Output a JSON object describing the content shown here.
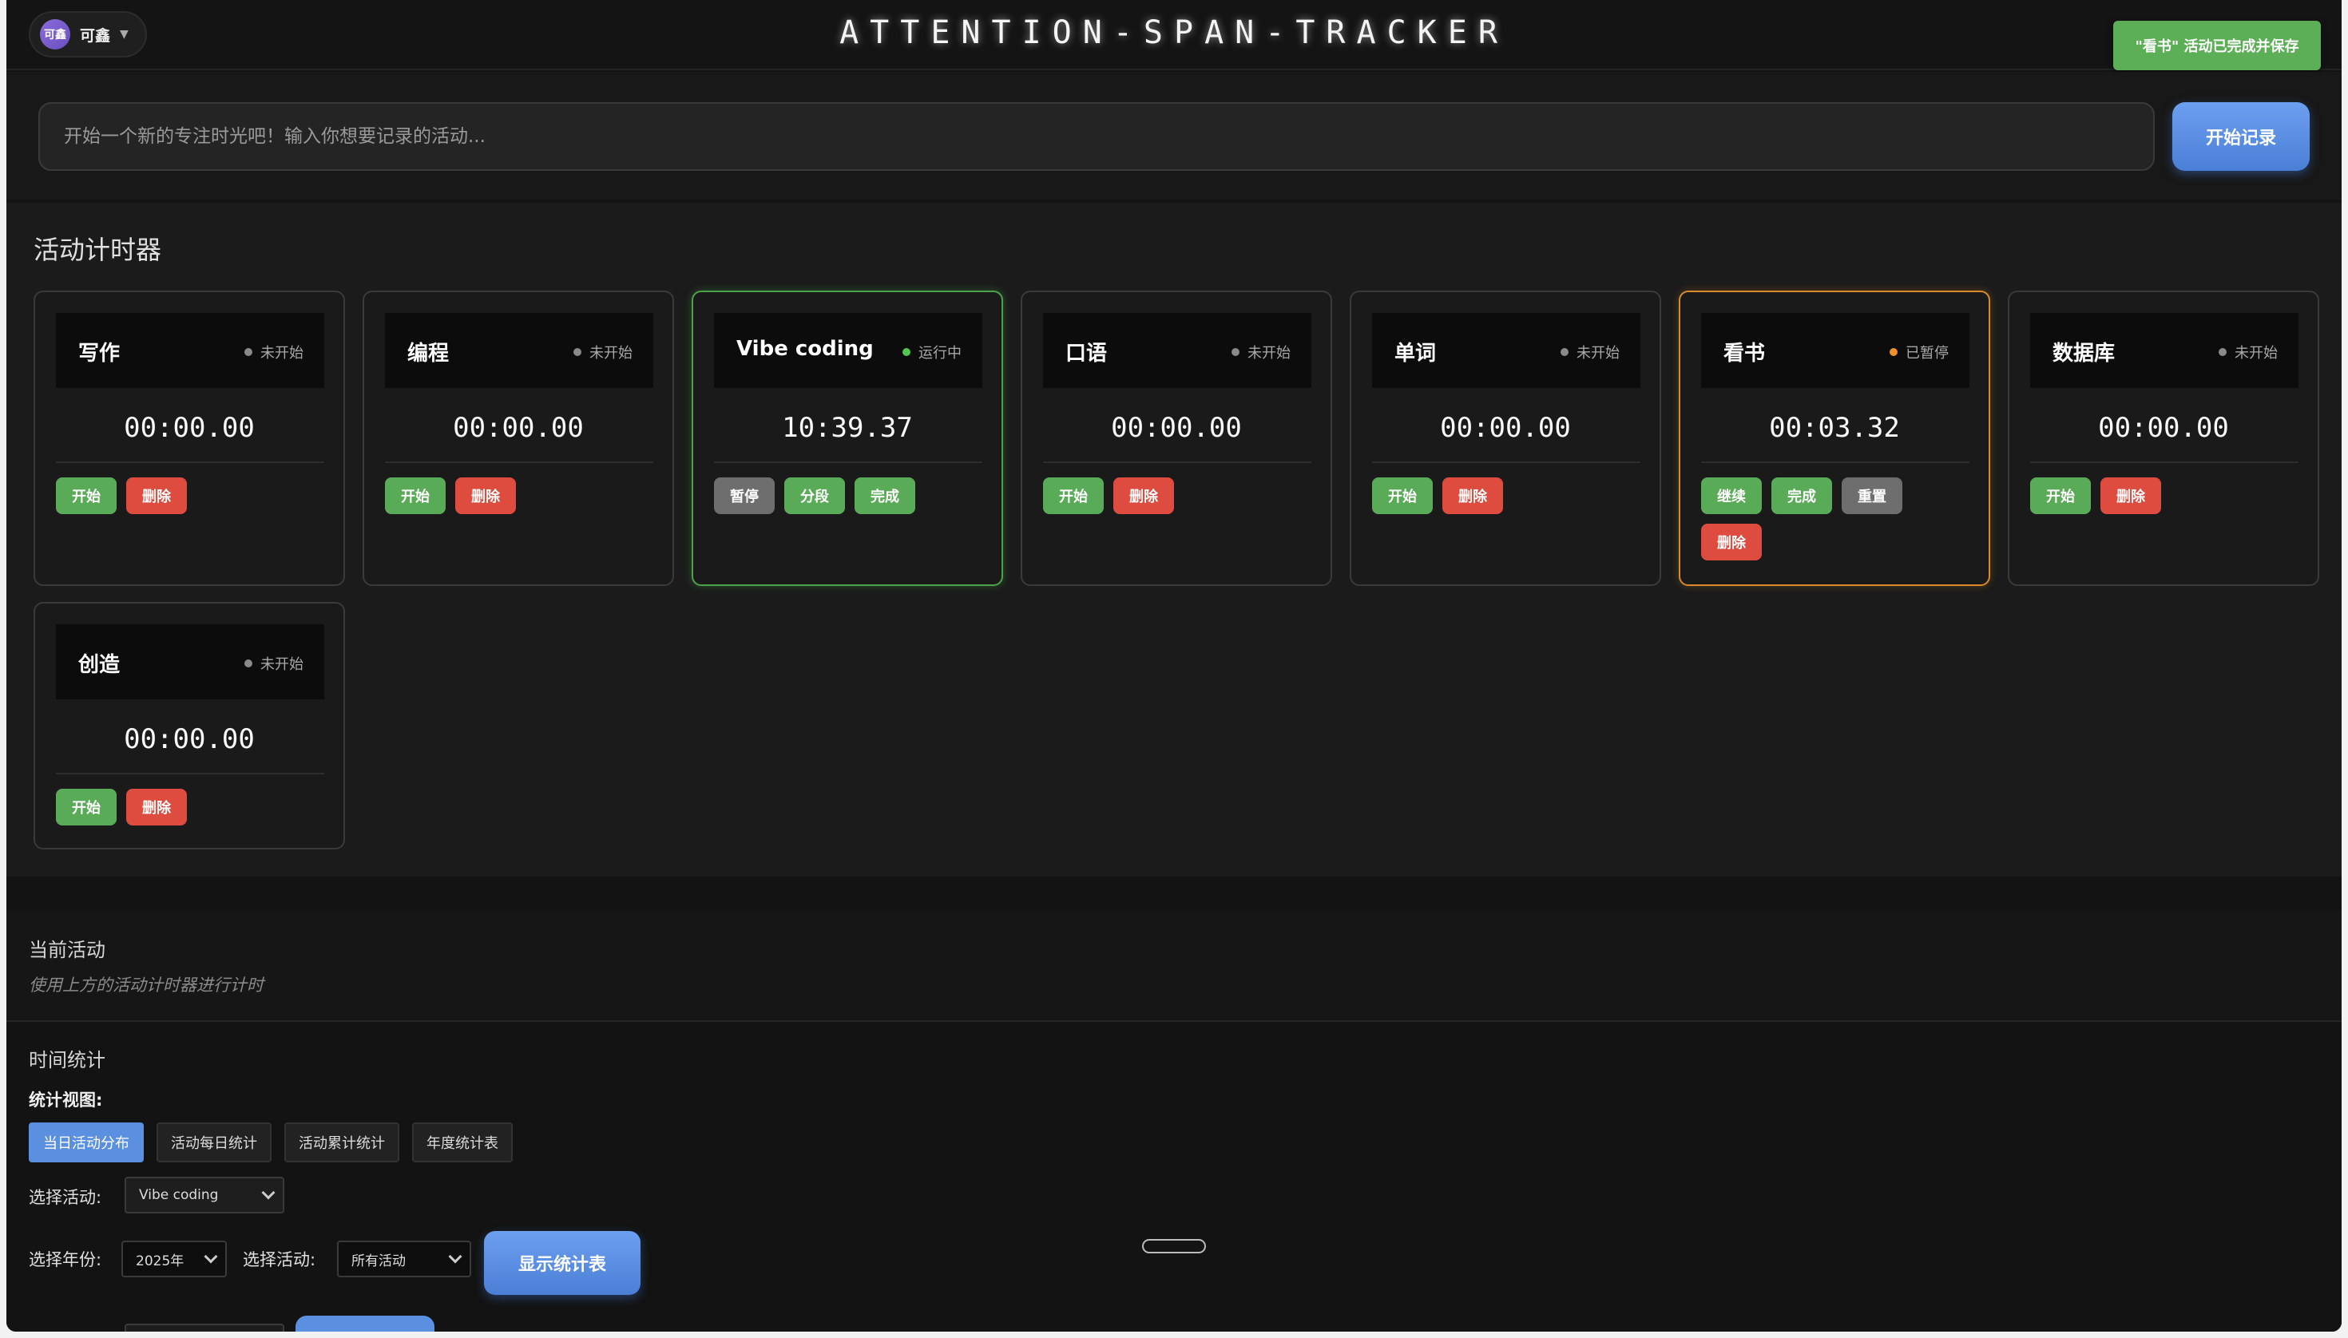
{
  "header": {
    "title": "ATTENTION-SPAN-TRACKER",
    "user": {
      "avatar_text": "可鑫",
      "name": "可鑫",
      "caret": "▼"
    },
    "toast": "\"看书\" 活动已完成并保存"
  },
  "new_activity": {
    "placeholder": "开始一个新的专注时光吧！输入你想要记录的活动...",
    "start_label": "开始记录"
  },
  "timers": {
    "title": "活动计时器",
    "cards": [
      {
        "name": "写作",
        "status": "未开始",
        "time": "00:00.00",
        "buttons": [
          "开始",
          "删除"
        ]
      },
      {
        "name": "编程",
        "status": "未开始",
        "time": "00:00.00",
        "buttons": [
          "开始",
          "删除"
        ]
      },
      {
        "name": "Vibe coding",
        "status": "运行中",
        "time": "10:39.37",
        "buttons": [
          "暂停",
          "分段",
          "完成"
        ]
      },
      {
        "name": "口语",
        "status": "未开始",
        "time": "00:00.00",
        "buttons": [
          "开始",
          "删除"
        ]
      },
      {
        "name": "单词",
        "status": "未开始",
        "time": "00:00.00",
        "buttons": [
          "开始",
          "删除"
        ]
      },
      {
        "name": "看书",
        "status": "已暂停",
        "time": "00:03.32",
        "buttons": [
          "继续",
          "完成",
          "重置",
          "删除"
        ]
      },
      {
        "name": "数据库",
        "status": "未开始",
        "time": "00:00.00",
        "buttons": [
          "开始",
          "删除"
        ]
      },
      {
        "name": "创造",
        "status": "未开始",
        "time": "00:00.00",
        "buttons": [
          "开始",
          "删除"
        ]
      }
    ]
  },
  "current": {
    "title": "当前活动",
    "hint": "使用上方的活动计时器进行计时"
  },
  "stats": {
    "title": "时间统计",
    "view_label": "统计视图:",
    "tabs": [
      "当日活动分布",
      "活动每日统计",
      "活动累计统计",
      "年度统计表"
    ],
    "select_activity_label": "选择活动:",
    "selected_activity": "Vibe coding",
    "year_label": "选择年份:",
    "selected_year": "2025年",
    "select_activity_label_2": "选择活动:",
    "selected_activity_2": "所有活动",
    "show_label": "显示统计表"
  },
  "colors": {
    "accent_blue": "#5b8fe0",
    "success_green": "#5aab57",
    "danger_red": "#dd4c3f",
    "running_border": "#4aa34a",
    "paused_border": "#d98a2a"
  }
}
